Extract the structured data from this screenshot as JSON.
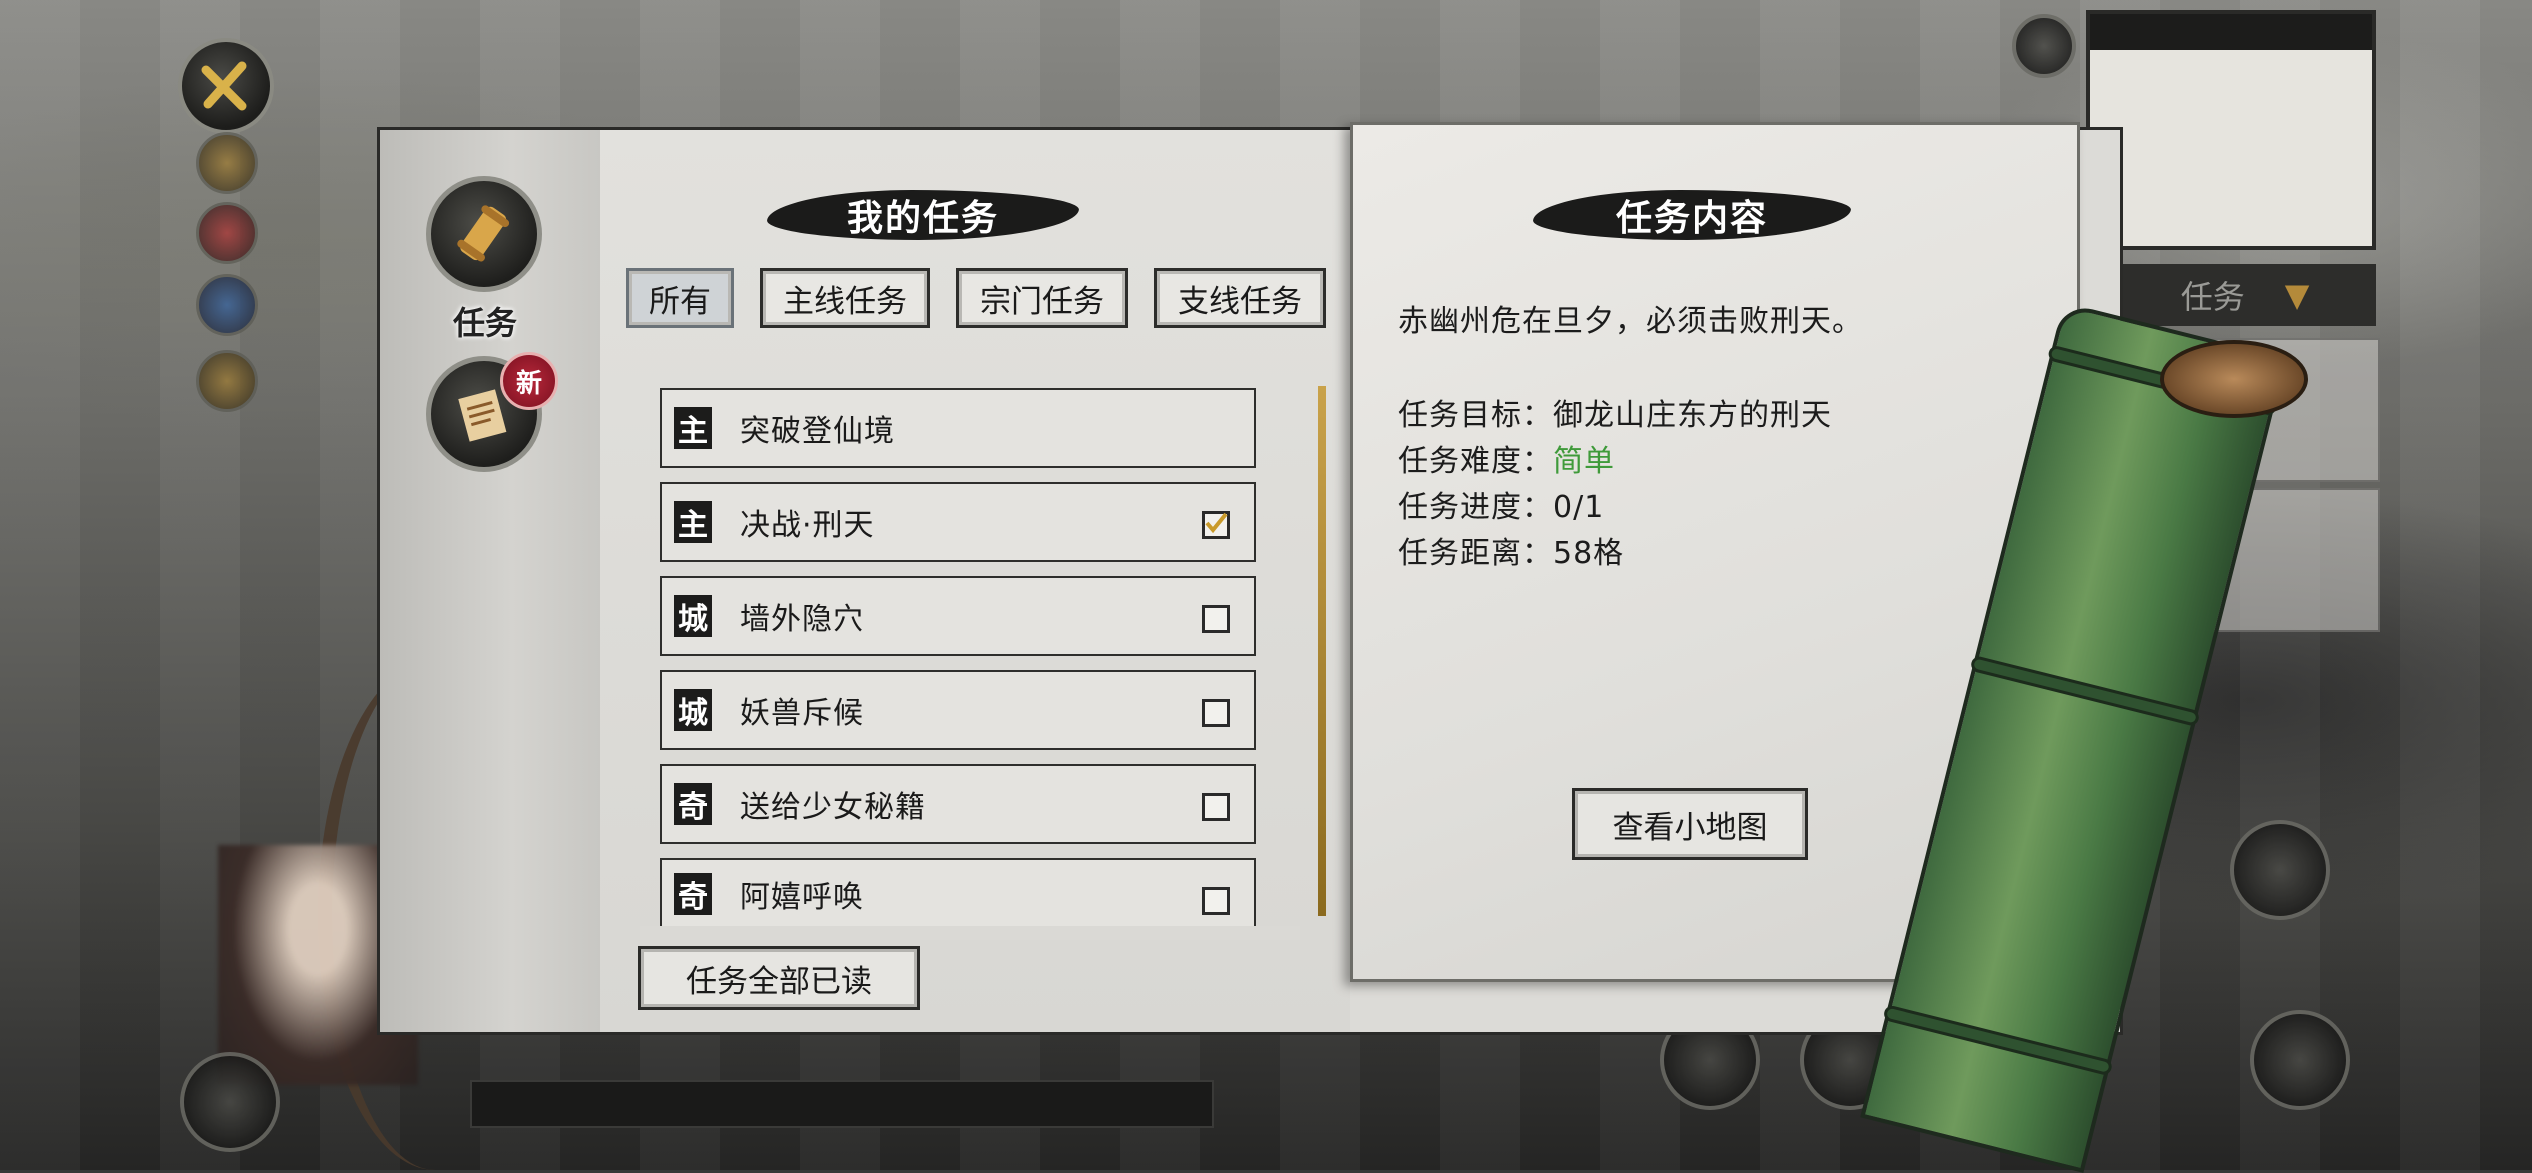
{
  "my_tasks": {
    "title": "我的任务",
    "tabs": [
      {
        "label": "所有",
        "active": true
      },
      {
        "label": "主线任务",
        "active": false
      },
      {
        "label": "宗门任务",
        "active": false
      },
      {
        "label": "支线任务",
        "active": false
      }
    ],
    "quests": [
      {
        "tag": "主",
        "name": "突破登仙境",
        "checkbox": "none"
      },
      {
        "tag": "主",
        "name": "决战·刑天",
        "checkbox": "checked"
      },
      {
        "tag": "城",
        "name": "墙外隐穴",
        "checkbox": "unchecked"
      },
      {
        "tag": "城",
        "name": "妖兽斥候",
        "checkbox": "unchecked"
      },
      {
        "tag": "奇",
        "name": "送给少女秘籍",
        "checkbox": "unchecked"
      },
      {
        "tag": "奇",
        "name": "阿嬉呼唤",
        "checkbox": "unchecked"
      }
    ],
    "mark_all_read_label": "任务全部已读"
  },
  "side_menu": {
    "quest_label": "任务",
    "new_badge": "新"
  },
  "task_content": {
    "title": "任务内容",
    "description": "赤幽州危在旦夕，必须击败刑天。",
    "target_label": "任务目标：",
    "target_value": "御龙山庄东方的刑天",
    "difficulty_label": "任务难度：",
    "difficulty_value": "简单",
    "difficulty_color": "#3f9a3a",
    "progress_label": "任务进度：",
    "progress_value": "0/1",
    "distance_label": "任务距离：",
    "distance_value": "58格",
    "view_map_label": "查看小地图"
  },
  "background_hud": {
    "quest_dropdown_label": "任务"
  }
}
